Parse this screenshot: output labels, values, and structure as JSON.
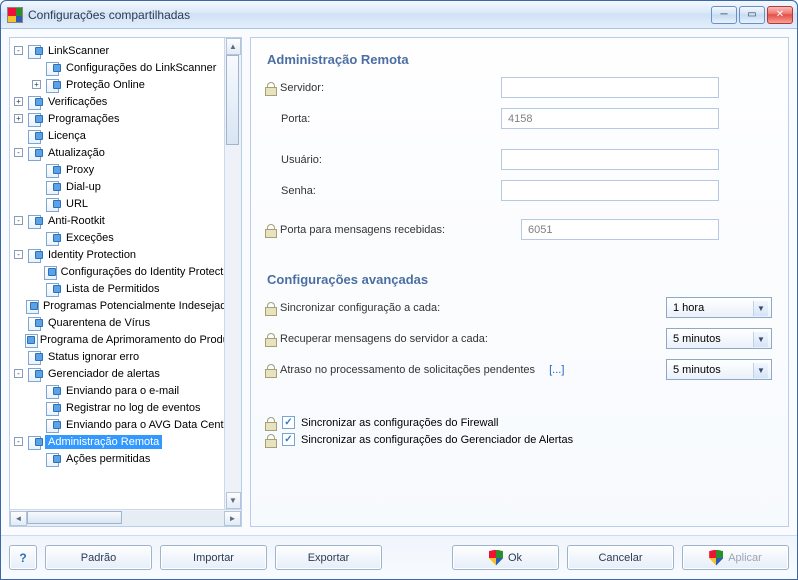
{
  "window": {
    "title": "Configurações compartilhadas"
  },
  "tree": {
    "items": [
      {
        "depth": 0,
        "toggle": "-",
        "label": "LinkScanner"
      },
      {
        "depth": 1,
        "toggle": "",
        "label": "Configurações do LinkScanner"
      },
      {
        "depth": 1,
        "toggle": "+",
        "label": "Proteção Online"
      },
      {
        "depth": 0,
        "toggle": "+",
        "label": "Verificações"
      },
      {
        "depth": 0,
        "toggle": "+",
        "label": "Programações"
      },
      {
        "depth": 0,
        "toggle": "",
        "label": "Licença"
      },
      {
        "depth": 0,
        "toggle": "-",
        "label": "Atualização"
      },
      {
        "depth": 1,
        "toggle": "",
        "label": "Proxy"
      },
      {
        "depth": 1,
        "toggle": "",
        "label": "Dial-up"
      },
      {
        "depth": 1,
        "toggle": "",
        "label": "URL"
      },
      {
        "depth": 0,
        "toggle": "-",
        "label": "Anti-Rootkit"
      },
      {
        "depth": 1,
        "toggle": "",
        "label": "Exceções"
      },
      {
        "depth": 0,
        "toggle": "-",
        "label": "Identity Protection"
      },
      {
        "depth": 1,
        "toggle": "",
        "label": "Configurações do Identity Protection"
      },
      {
        "depth": 1,
        "toggle": "",
        "label": "Lista de Permitidos"
      },
      {
        "depth": 0,
        "toggle": "",
        "label": "Programas Potencialmente Indesejados"
      },
      {
        "depth": 0,
        "toggle": "",
        "label": "Quarentena de Vírus"
      },
      {
        "depth": 0,
        "toggle": "",
        "label": "Programa de Aprimoramento do Produto"
      },
      {
        "depth": 0,
        "toggle": "",
        "label": "Status ignorar erro"
      },
      {
        "depth": 0,
        "toggle": "-",
        "label": "Gerenciador de alertas"
      },
      {
        "depth": 1,
        "toggle": "",
        "label": "Enviando para o e-mail"
      },
      {
        "depth": 1,
        "toggle": "",
        "label": "Registrar no log de eventos"
      },
      {
        "depth": 1,
        "toggle": "",
        "label": "Enviando para o AVG Data Center"
      },
      {
        "depth": 0,
        "toggle": "-",
        "label": "Administração Remota",
        "selected": true
      },
      {
        "depth": 1,
        "toggle": "",
        "label": "Ações permitidas"
      }
    ]
  },
  "content": {
    "title": "Administração Remota",
    "server_label": "Servidor:",
    "server_value": "",
    "port_label": "Porta:",
    "port_value": "4158",
    "user_label": "Usuário:",
    "user_value": "",
    "password_label": "Senha:",
    "password_value": "",
    "msgport_label": "Porta para mensagens recebidas:",
    "msgport_value": "6051",
    "adv_title": "Configurações avançadas",
    "sync_label": "Sincronizar configuração a cada:",
    "sync_value": "1 hora",
    "retrieve_label": "Recuperar mensagens do servidor a cada:",
    "retrieve_value": "5 minutos",
    "delay_label": "Atraso no processamento de solicitações pendentes",
    "delay_more": "[...]",
    "delay_value": "5 minutos",
    "chk_firewall": "Sincronizar as configurações do Firewall",
    "chk_alerts": "Sincronizar as configurações do Gerenciador de Alertas"
  },
  "footer": {
    "help": "?",
    "default": "Padrão",
    "import": "Importar",
    "export": "Exportar",
    "ok": "Ok",
    "cancel": "Cancelar",
    "apply": "Aplicar"
  }
}
